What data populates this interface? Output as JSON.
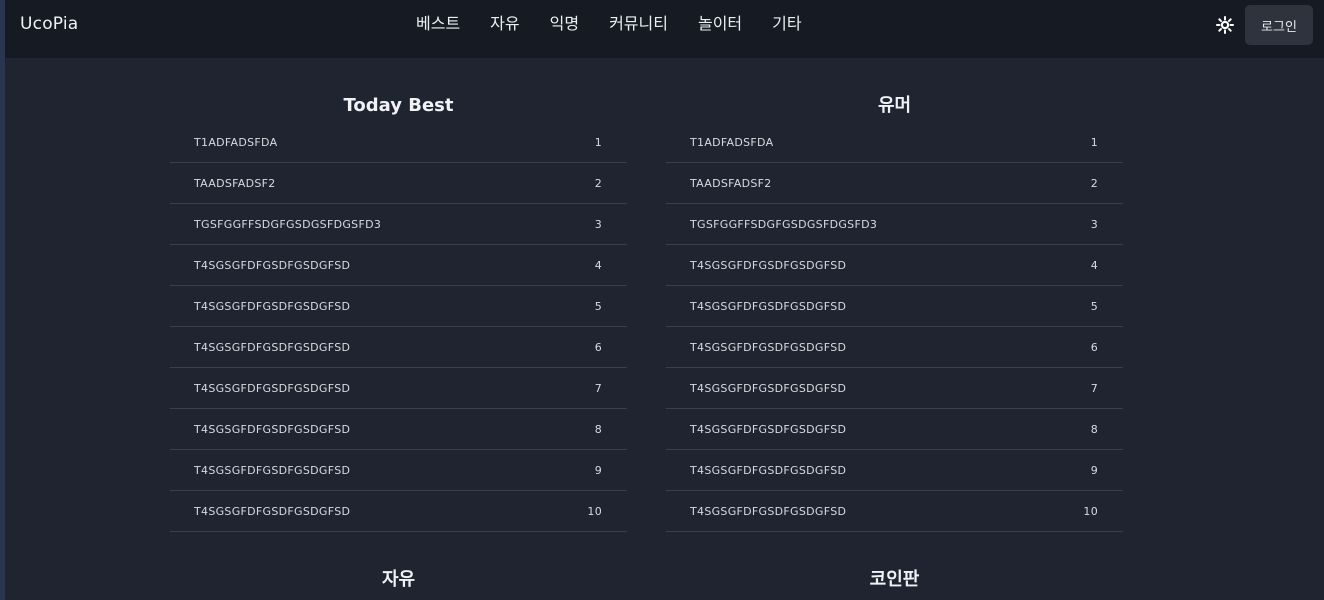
{
  "header": {
    "brand": "UcoPia",
    "nav": [
      "베스트",
      "자유",
      "익명",
      "커뮤니티",
      "놀이터",
      "기타"
    ],
    "login_label": "로그인",
    "theme_icon": "sun-icon"
  },
  "boards": {
    "best": {
      "title": "Today Best",
      "rows": [
        {
          "title": "T1ADFADSFDA",
          "num": "1"
        },
        {
          "title": "TAADSFADSF2",
          "num": "2"
        },
        {
          "title": "TGSFGGFFSDGFGSDGSFDGSFD3",
          "num": "3"
        },
        {
          "title": "T4SGSGFDFGSDFGSDGFSD",
          "num": "4"
        },
        {
          "title": "T4SGSGFDFGSDFGSDGFSD",
          "num": "5"
        },
        {
          "title": "T4SGSGFDFGSDFGSDGFSD",
          "num": "6"
        },
        {
          "title": "T4SGSGFDFGSDFGSDGFSD",
          "num": "7"
        },
        {
          "title": "T4SGSGFDFGSDFGSDGFSD",
          "num": "8"
        },
        {
          "title": "T4SGSGFDFGSDFGSDGFSD",
          "num": "9"
        },
        {
          "title": "T4SGSGFDFGSDFGSDGFSD",
          "num": "10"
        }
      ]
    },
    "humor": {
      "title": "유머",
      "rows": [
        {
          "title": "T1ADFADSFDA",
          "num": "1"
        },
        {
          "title": "TAADSFADSF2",
          "num": "2"
        },
        {
          "title": "TGSFGGFFSDGFGSDGSFDGSFD3",
          "num": "3"
        },
        {
          "title": "T4SGSGFDFGSDFGSDGFSD",
          "num": "4"
        },
        {
          "title": "T4SGSGFDFGSDFGSDGFSD",
          "num": "5"
        },
        {
          "title": "T4SGSGFDFGSDFGSDGFSD",
          "num": "6"
        },
        {
          "title": "T4SGSGFDFGSDFGSDGFSD",
          "num": "7"
        },
        {
          "title": "T4SGSGFDFGSDFGSDGFSD",
          "num": "8"
        },
        {
          "title": "T4SGSGFDFGSDFGSDGFSD",
          "num": "9"
        },
        {
          "title": "T4SGSGFDFGSDFGSDGFSD",
          "num": "10"
        }
      ]
    },
    "free": {
      "title": "자유",
      "rows": []
    },
    "coin": {
      "title": "코인판",
      "rows": []
    }
  },
  "colors": {
    "page_bg": "#1f2430",
    "header_bg": "#161a22",
    "divider": "#3a3f4b",
    "button_bg": "#2f333d"
  }
}
